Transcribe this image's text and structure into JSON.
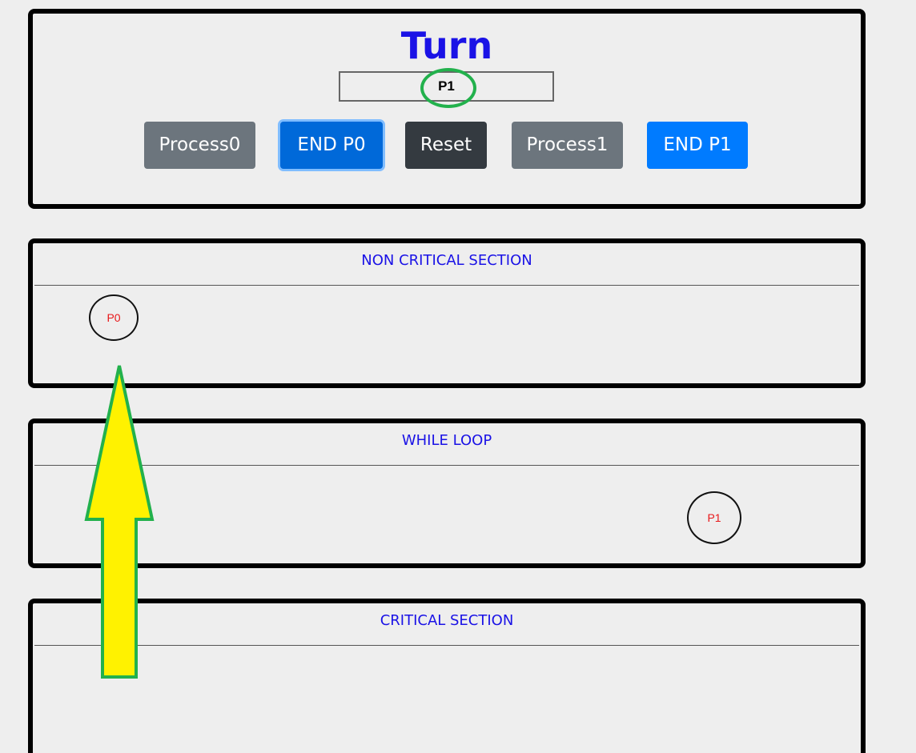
{
  "turn_panel": {
    "title": "Turn",
    "turn_value": "P1"
  },
  "buttons": {
    "process0": "Process0",
    "end_p0": "END P0",
    "reset": "Reset",
    "process1": "Process1",
    "end_p1": "END P1"
  },
  "sections": {
    "non_critical": "NON CRITICAL SECTION",
    "while_loop": "WHILE LOOP",
    "critical": "CRITICAL SECTION"
  },
  "processes": {
    "p0": "P0",
    "p1": "P1"
  },
  "colors": {
    "title": "#1a12e6",
    "process_label": "#e8181a",
    "highlight_circle": "#22b14c",
    "arrow_fill": "#fff200",
    "arrow_outline": "#22b14c"
  },
  "annotations": {
    "arrow": "up-arrow-icon",
    "turn_highlight": "ellipse-highlight"
  }
}
